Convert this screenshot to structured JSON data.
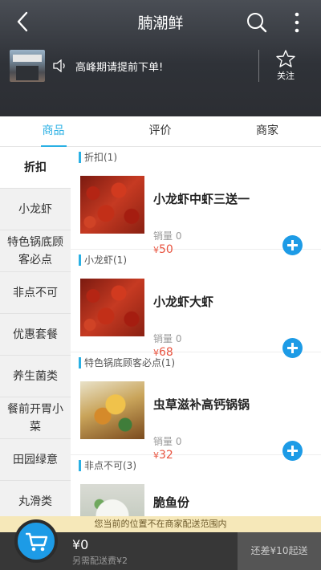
{
  "header": {
    "title": "腩潮鲜",
    "notice": "高峰期请提前下单!",
    "follow_label": "关注"
  },
  "tabs": [
    {
      "label": "商品",
      "active": true
    },
    {
      "label": "评价",
      "active": false
    },
    {
      "label": "商家",
      "active": false
    }
  ],
  "sidebar": {
    "items": [
      {
        "label": "折扣",
        "active": true
      },
      {
        "label": "小龙虾",
        "active": false
      },
      {
        "label": "特色锅底顾客必点",
        "active": false
      },
      {
        "label": "非点不可",
        "active": false
      },
      {
        "label": "优惠套餐",
        "active": false
      },
      {
        "label": "养生菌类",
        "active": false
      },
      {
        "label": "餐前开胃小菜",
        "active": false
      },
      {
        "label": "田园绿意",
        "active": false
      },
      {
        "label": "丸滑类",
        "active": false
      }
    ]
  },
  "sections": [
    {
      "header": "折扣(1)",
      "items": [
        {
          "name": "小龙虾中虾三送一",
          "sales": "销量 0",
          "currency": "¥",
          "price": "50",
          "image": "crayfish-photo"
        }
      ]
    },
    {
      "header": "小龙虾(1)",
      "items": [
        {
          "name": "小龙虾大虾",
          "sales": "销量 0",
          "currency": "¥",
          "price": "68",
          "image": "crayfish-photo"
        }
      ]
    },
    {
      "header": "特色锅底顾客必点(1)",
      "items": [
        {
          "name": "虫草滋补高钙锅锅",
          "sales": "销量 0",
          "currency": "¥",
          "price": "32",
          "image": "hotpot-photo"
        }
      ]
    },
    {
      "header": "非点不可(3)",
      "items": [
        {
          "name": "脆鱼份",
          "sales": "",
          "currency": "",
          "price": "",
          "image": "fish-photo"
        }
      ]
    }
  ],
  "footer": {
    "warning": "您当前的位置不在商家配送范围内",
    "total": "¥0",
    "delivery_fee": "另需配送费¥2",
    "checkout_label": "还差¥10起送"
  },
  "colors": {
    "accent": "#2ab0e4",
    "add_button": "#1d9be6",
    "price": "#e8533f",
    "footer_bg": "#373737"
  }
}
